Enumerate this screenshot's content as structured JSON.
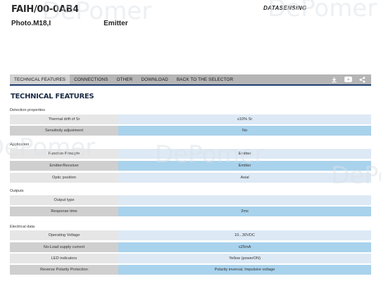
{
  "product": {
    "code": "FAIH/00-0AB4",
    "title": "Photo.M18,I                           Emitter"
  },
  "brand": "DATASENSING",
  "watermark": "DePomer",
  "nav": {
    "tabs": [
      "TECHNICAL FEATURES",
      "CONNECTIONS",
      "OTHER",
      "DOWNLOAD",
      "BACK TO THE SELECTOR"
    ],
    "active_tab": "TECHNICAL FEATURES",
    "icons": [
      "download-icon",
      "video-icon",
      "share-icon"
    ]
  },
  "section_title": "TECHNICAL FEATURES",
  "groups": [
    {
      "label": "Detection properties",
      "rows": [
        {
          "key": "Thermal drift of Sr",
          "value": "≤10% Sr"
        },
        {
          "key": "Sensitivity adjustment",
          "value": "No"
        }
      ]
    },
    {
      "label": "Application",
      "rows": [
        {
          "key": "Function Principle",
          "value": "Emitter"
        },
        {
          "key": "Emitter/Receiver",
          "value": "Emitter"
        },
        {
          "key": "Optic position",
          "value": "Axial"
        }
      ]
    },
    {
      "label": "Outputs",
      "rows": [
        {
          "key": "Output type",
          "value": ""
        },
        {
          "key": "Response time",
          "value": "2ms"
        }
      ]
    },
    {
      "label": "Electrical data",
      "rows": [
        {
          "key": "Operating Voltage",
          "value": "10...30VDC"
        },
        {
          "key": "No-Load supply current",
          "value": "≤25mA"
        },
        {
          "key": "LED indicators",
          "value": "Yellow (powerON)"
        },
        {
          "key": "Reverse Polarity Protection",
          "value": "Polarity inversal, Impulsive voltage"
        }
      ]
    }
  ],
  "colors": {
    "navbar": "#b5b5b5",
    "navbar_border": "#1c3d6e",
    "row_key": "#e6e6e6",
    "row_key_alt": "#cfcfcf",
    "row_value": "#dde9f5",
    "row_value_alt": "#a9d2ec"
  }
}
